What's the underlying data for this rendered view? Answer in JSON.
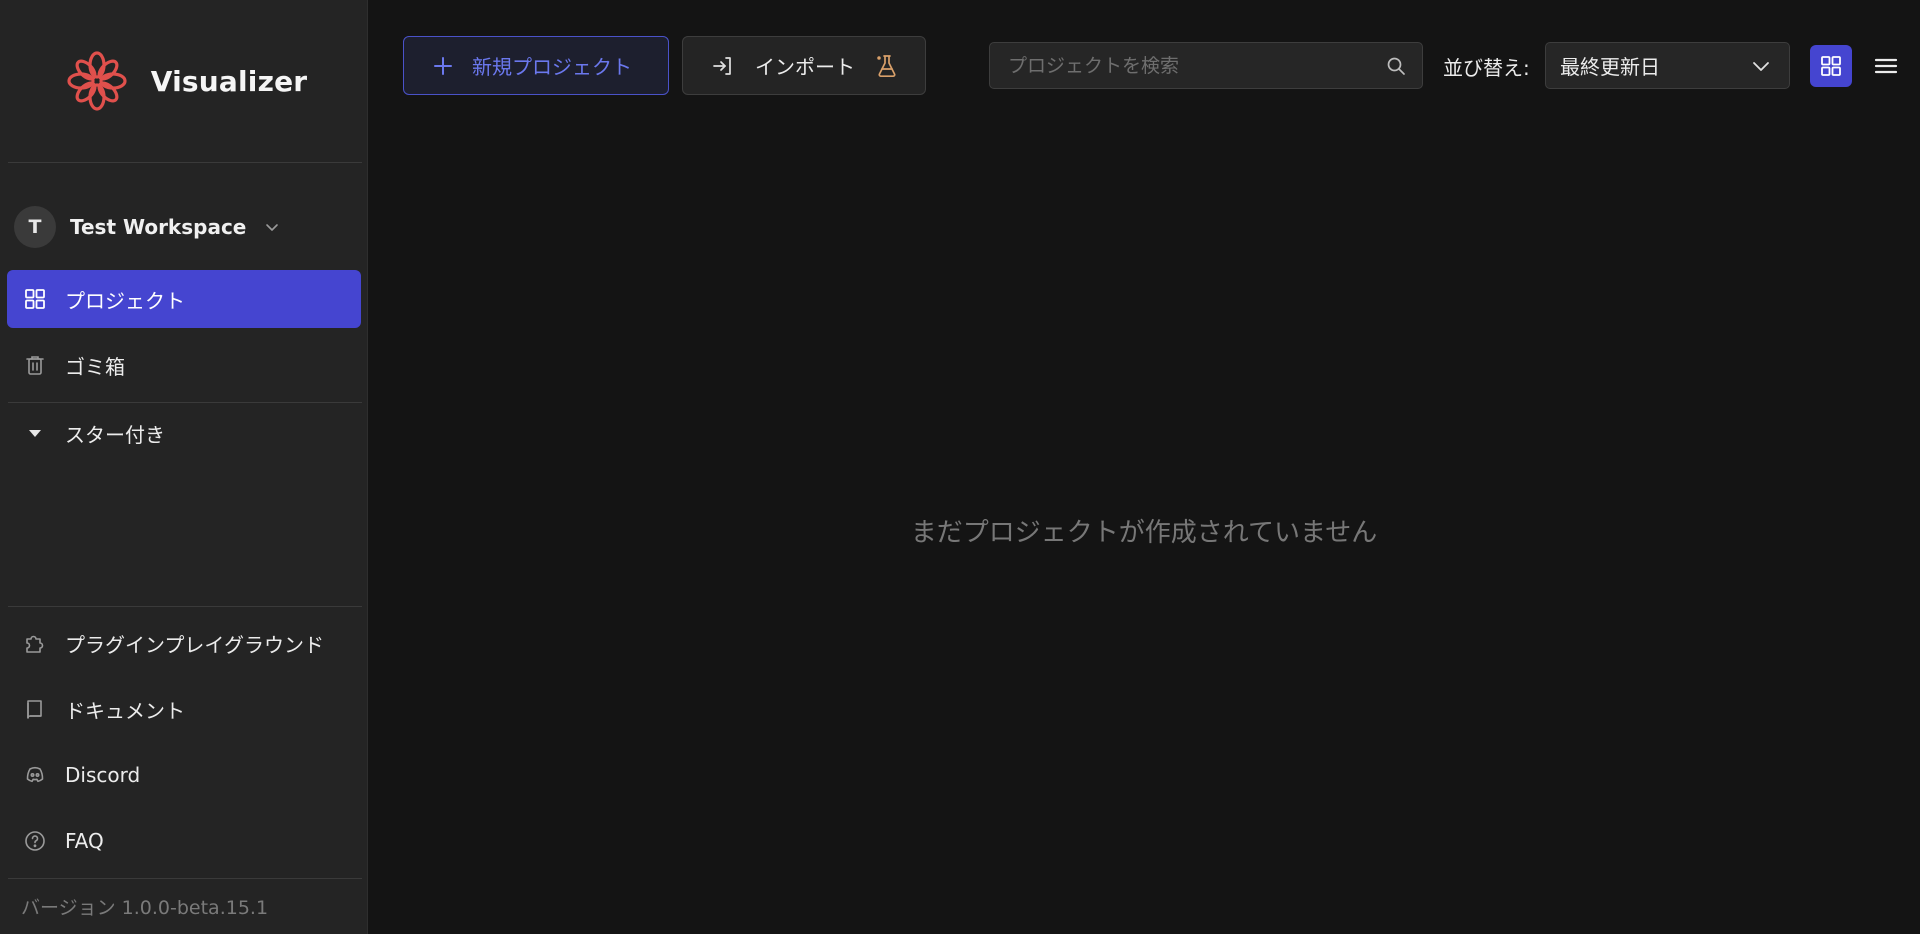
{
  "app": {
    "name": "Visualizer",
    "accent_color": "#4545d0",
    "logo_color": "#e0504c"
  },
  "workspace": {
    "avatar_letter": "T",
    "name": "Test Workspace"
  },
  "sidebar": {
    "nav": [
      {
        "label": "プロジェクト",
        "icon": "grid-icon",
        "active": true
      },
      {
        "label": "ゴミ箱",
        "icon": "trash-icon",
        "active": false
      }
    ],
    "starred_label": "スター付き",
    "bottom": [
      {
        "label": "プラグインプレイグラウンド",
        "icon": "puzzle-icon"
      },
      {
        "label": "ドキュメント",
        "icon": "book-icon"
      },
      {
        "label": "Discord",
        "icon": "discord-icon"
      },
      {
        "label": "FAQ",
        "icon": "help-circle-icon"
      }
    ],
    "version": "バージョン 1.0.0-beta.15.1"
  },
  "toolbar": {
    "new_project_label": "新規プロジェクト",
    "import_label": "インポート",
    "search_placeholder": "プロジェクトを検索",
    "search_value": "",
    "sort_label": "並び替え:",
    "sort_value": "最終更新日"
  },
  "main": {
    "empty_message": "まだプロジェクトが作成されていません"
  }
}
